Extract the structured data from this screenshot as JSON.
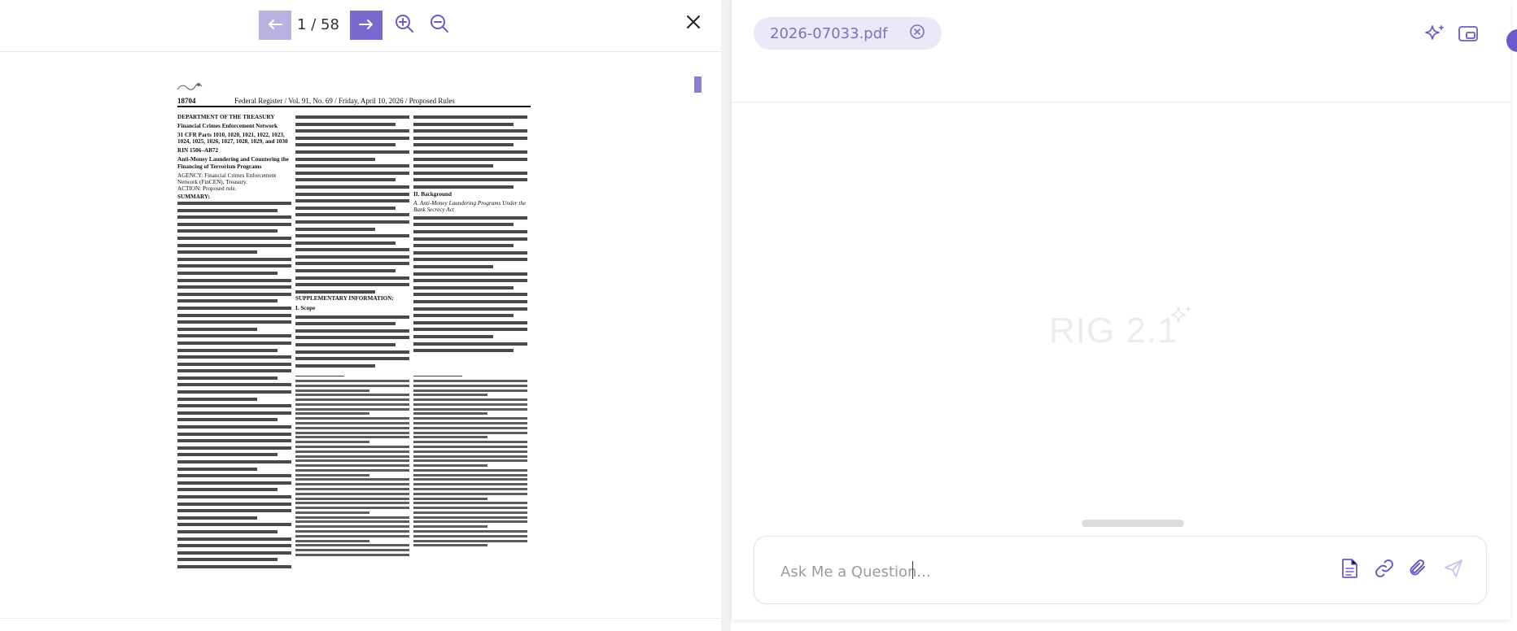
{
  "viewer": {
    "page_current": "1",
    "page_separator": "/",
    "page_total": "58",
    "icons": {
      "prev": "arrow-left-icon",
      "next": "arrow-right-icon",
      "zoom_in": "zoom-in-icon",
      "zoom_out": "zoom-out-icon",
      "close": "close-icon"
    },
    "colors": {
      "prev_button": "#b9b2e0",
      "next_button": "#7a6ad0",
      "icon": "#6a5acd"
    }
  },
  "document": {
    "logo_text": "[logo]",
    "page_number": "18704",
    "running_title": "Federal Register / Vol. 91, No. 69 / Friday, April 10, 2026 / Proposed Rules",
    "agency": "DEPARTMENT OF THE TREASURY",
    "sub_agency": "Financial Crimes Enforcement Network",
    "cfr_parts": "31 CFR Parts 1010, 1020, 1021, 1022, 1023, 1024, 1025, 1026, 1027, 1028, 1029, and 1030",
    "rin": "RIN 1506–AB72",
    "rule_title": "Anti-Money Laundering and Countering the Financing of Terrorism Programs",
    "agency_label": "AGENCY: Financial Crimes Enforcement Network (FinCEN), Treasury.",
    "action_label": "ACTION: Proposed rule.",
    "summary_label": "SUMMARY:",
    "col2_heading": "SUPPLEMENTARY INFORMATION:",
    "col2_section": "I. Scope",
    "col3_section": "II. Background",
    "col3_subsection": "A. Anti-Money Laundering Programs Under the Bank Secrecy Act"
  },
  "chat": {
    "file_chip_name": "2026-07033.pdf",
    "watermark": "RIG 2.1",
    "input_placeholder": "Ask Me a Question...",
    "icons": {
      "chip_close": "close-circle-icon",
      "sparkle": "sparkle-icon",
      "layout": "window-layout-icon",
      "document": "document-icon",
      "link": "link-icon",
      "attach": "paperclip-icon",
      "send": "send-icon"
    },
    "colors": {
      "accent": "#6a5acd",
      "chip_bg": "#ebe8f8",
      "chip_text": "#7b72b8"
    }
  }
}
